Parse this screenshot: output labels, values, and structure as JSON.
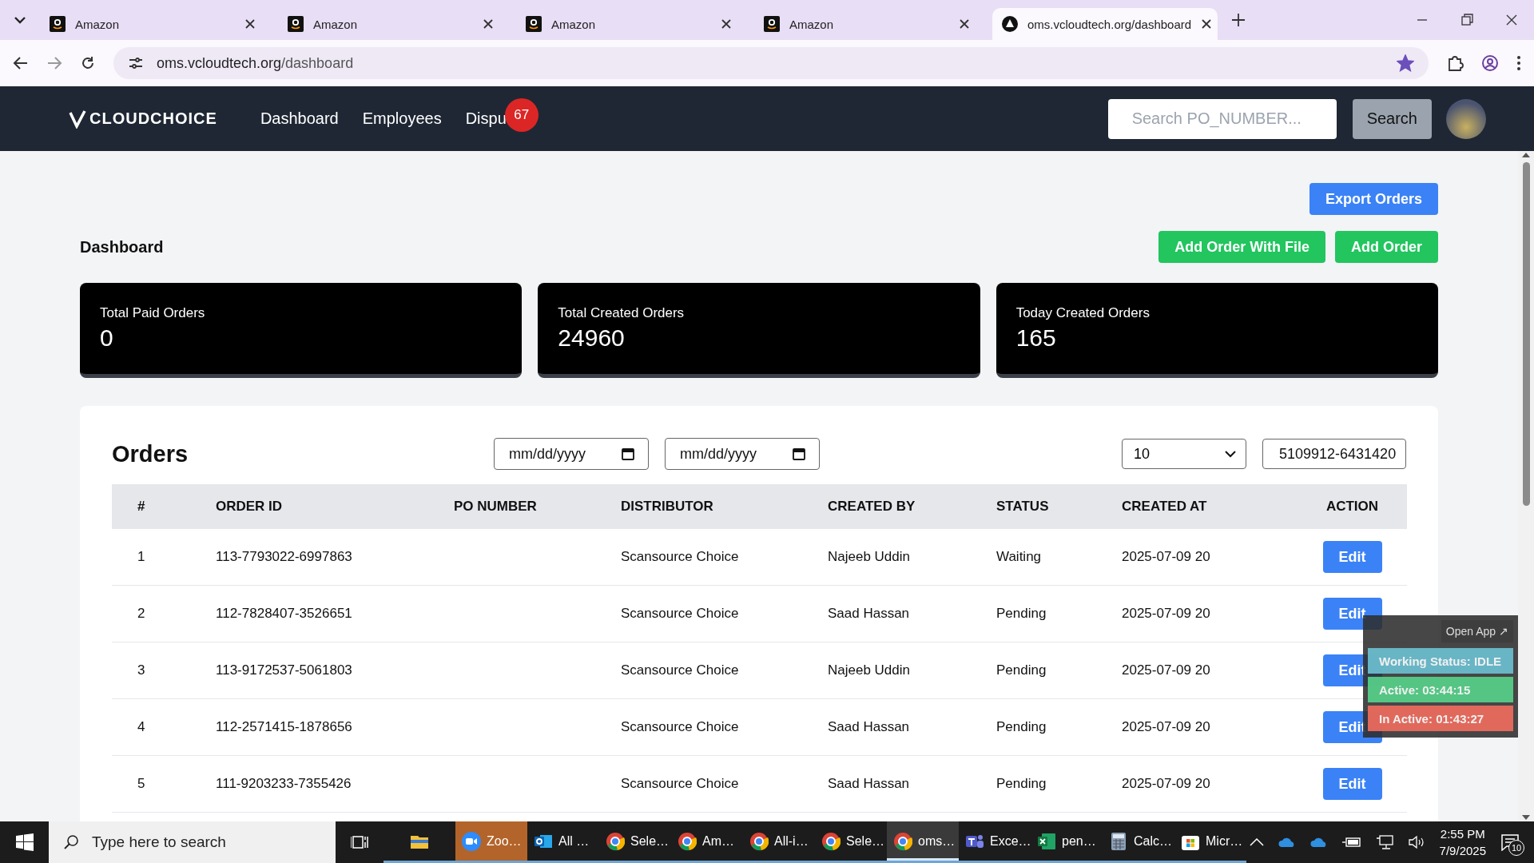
{
  "browser": {
    "tabs": [
      {
        "title": "Amazon",
        "kind": "amazon",
        "selected": false
      },
      {
        "title": "Amazon",
        "kind": "amazon",
        "selected": false
      },
      {
        "title": "Amazon",
        "kind": "amazon",
        "selected": false
      },
      {
        "title": "Amazon",
        "kind": "amazon",
        "selected": false
      },
      {
        "title": "oms.vcloudtech.org/dashboard",
        "kind": "site",
        "selected": true
      }
    ],
    "url_host": "oms.vcloudtech.org",
    "url_path": "/dashboard",
    "bookmarked": true
  },
  "nav": {
    "logo_text": "CLOUDCHOICE",
    "links": [
      {
        "label": "Dashboard"
      },
      {
        "label": "Employees"
      },
      {
        "label": "Dispu",
        "badge": "67"
      }
    ],
    "search": {
      "placeholder": "Search PO_NUMBER..."
    },
    "search_button": "Search"
  },
  "dashboard": {
    "export_button": "Export Orders",
    "title": "Dashboard",
    "add_file_button": "Add Order With File",
    "add_button": "Add Order",
    "stats": [
      {
        "label": "Total Paid Orders",
        "value": "0"
      },
      {
        "label": "Total Created Orders",
        "value": "24960"
      },
      {
        "label": "Today Created Orders",
        "value": "165"
      }
    ]
  },
  "orders": {
    "title": "Orders",
    "date_from": {
      "placeholder": "mm/dd/yyyy"
    },
    "date_to": {
      "placeholder": "mm/dd/yyyy"
    },
    "page_size": "10",
    "search_value": "5109912-6431420",
    "columns": [
      "#",
      "ORDER ID",
      "PO NUMBER",
      "DISTRIBUTOR",
      "CREATED BY",
      "STATUS",
      "CREATED AT",
      "ACTION"
    ],
    "rows": [
      {
        "num": "1",
        "order_id": "113-7793022-6997863",
        "distributor": "Scansource Choice",
        "created_by": "Najeeb Uddin",
        "status": "Waiting",
        "created_at": "2025-07-09 20",
        "action": "Edit"
      },
      {
        "num": "2",
        "order_id": "112-7828407-3526651",
        "distributor": "Scansource Choice",
        "created_by": "Saad Hassan",
        "status": "Pending",
        "created_at": "2025-07-09 20",
        "action": "Edit"
      },
      {
        "num": "3",
        "order_id": "113-9172537-5061803",
        "distributor": "Scansource Choice",
        "created_by": "Najeeb Uddin",
        "status": "Pending",
        "created_at": "2025-07-09 20",
        "action": "Edit"
      },
      {
        "num": "4",
        "order_id": "112-2571415-1878656",
        "distributor": "Scansource Choice",
        "created_by": "Saad Hassan",
        "status": "Pending",
        "created_at": "2025-07-09 20",
        "action": "Edit"
      },
      {
        "num": "5",
        "order_id": "111-9203233-7355426",
        "distributor": "Scansource Choice",
        "created_by": "Saad Hassan",
        "status": "Pending",
        "created_at": "2025-07-09 20",
        "action": "Edit"
      }
    ]
  },
  "tracker": {
    "open_button": "Open App ↗",
    "items": [
      {
        "text": "Working Status: IDLE",
        "color": "#6bbfd0"
      },
      {
        "text": "Active: 03:44:15",
        "color": "#57d08a"
      },
      {
        "text": "In Active: 01:43:27",
        "color": "#ef6c5e"
      }
    ]
  },
  "taskbar": {
    "search_placeholder": "Type here to search",
    "apps": [
      {
        "kind": "folder",
        "selected": false,
        "attention": false
      },
      {
        "kind": "zoom",
        "label": "Zoo…",
        "selected": false,
        "attention": true
      },
      {
        "kind": "outlook",
        "label": "All …",
        "selected": false,
        "attention": false
      },
      {
        "kind": "chrome",
        "label": "Sele…",
        "selected": false,
        "attention": false
      },
      {
        "kind": "chrome",
        "label": "Am…",
        "selected": false,
        "attention": false
      },
      {
        "kind": "chrome",
        "label": "All-i…",
        "selected": false,
        "attention": false
      },
      {
        "kind": "chrome",
        "label": "Sele…",
        "selected": false,
        "attention": false
      },
      {
        "kind": "chrome",
        "label": "oms…",
        "selected": true,
        "attention": false
      },
      {
        "kind": "teams",
        "label": "Exce…",
        "selected": false,
        "attention": false
      },
      {
        "kind": "excel",
        "label": "pen…",
        "selected": false,
        "attention": false
      },
      {
        "kind": "calc",
        "label": "Calc…",
        "selected": false,
        "attention": false
      },
      {
        "kind": "store",
        "label": "Micr…",
        "selected": false,
        "attention": false
      }
    ],
    "time": "2:55 PM",
    "date": "7/9/2025",
    "notifications": "10"
  }
}
